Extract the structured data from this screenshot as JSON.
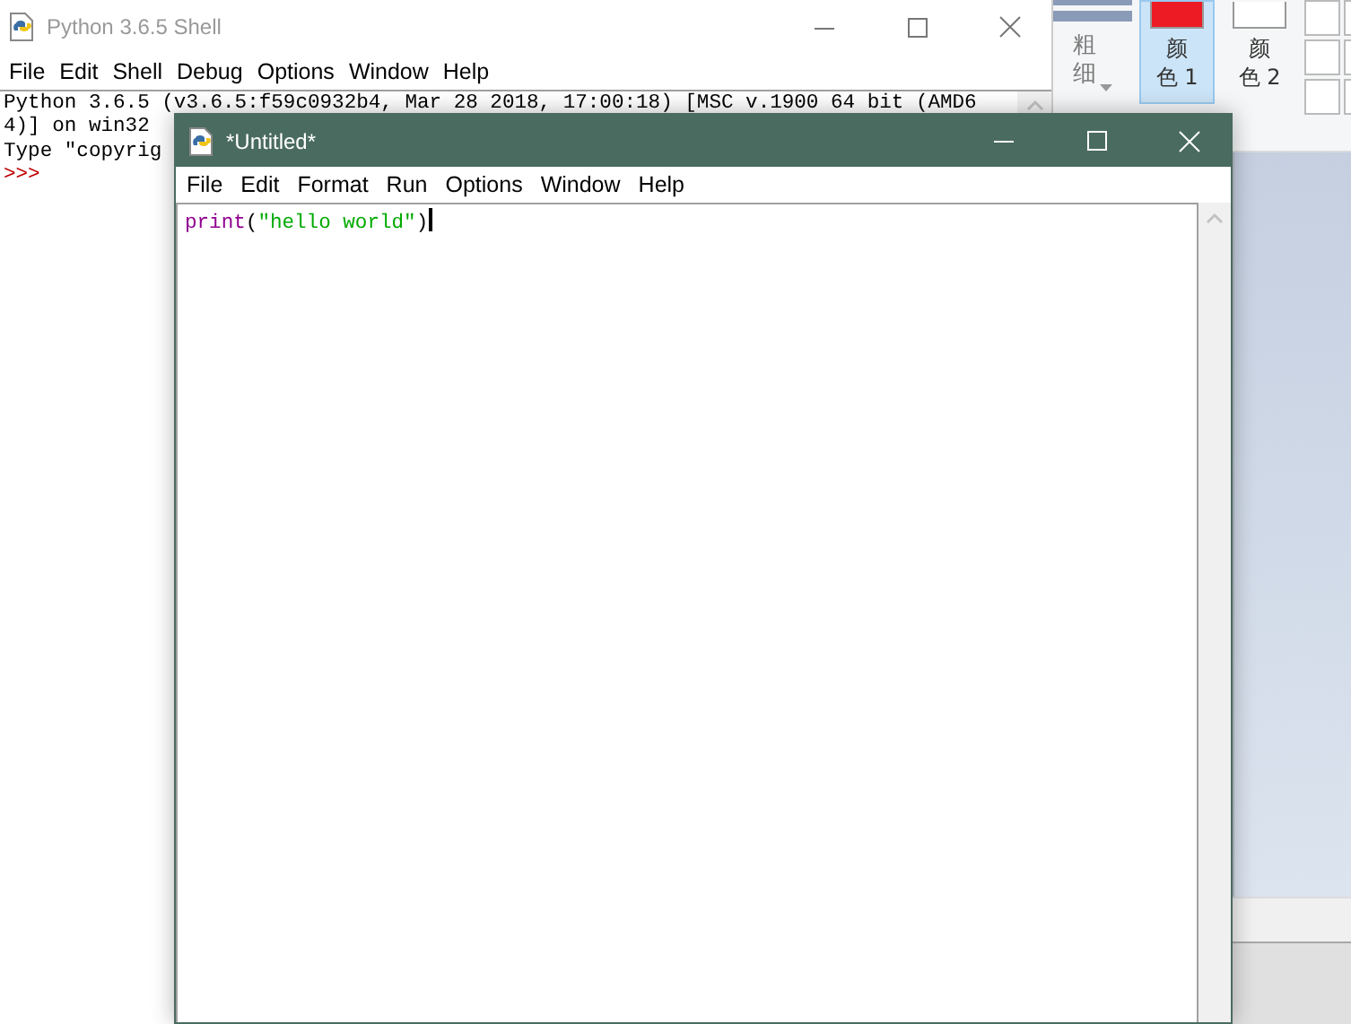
{
  "shell_window": {
    "title": "Python 3.6.5 Shell",
    "active": false,
    "menu": [
      "File",
      "Edit",
      "Shell",
      "Debug",
      "Options",
      "Window",
      "Help"
    ],
    "output_lines": [
      "Python 3.6.5 (v3.6.5:f59c0932b4, Mar 28 2018, 17:00:18) [MSC v.1900 64 bit (AMD6",
      "4)] on win32",
      "Type \"copyrig"
    ],
    "prompt": ">>>"
  },
  "paint_ribbon": {
    "size_label": "粗细",
    "colors": [
      {
        "label": "颜色 1",
        "color": "#ed1c24",
        "selected": true
      },
      {
        "label": "颜色 2",
        "color": "#ffffff",
        "selected": false
      }
    ]
  },
  "editor_window": {
    "title": "*Untitled*",
    "active": true,
    "menu": [
      "File",
      "Edit",
      "Format",
      "Run",
      "Options",
      "Window",
      "Help"
    ],
    "code_tokens": [
      {
        "text": "print",
        "kind": "builtin"
      },
      {
        "text": "(",
        "kind": "plain"
      },
      {
        "text": "\"hello world\"",
        "kind": "string"
      },
      {
        "text": ")",
        "kind": "plain"
      }
    ]
  }
}
